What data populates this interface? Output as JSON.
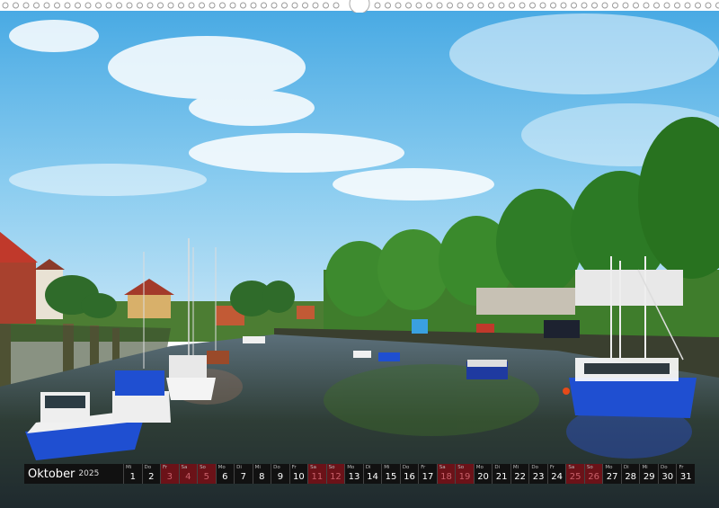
{
  "calendar": {
    "month": "Oktober",
    "year": "2025",
    "days": [
      {
        "dow": "Mi",
        "num": "1",
        "weekend": false
      },
      {
        "dow": "Do",
        "num": "2",
        "weekend": false
      },
      {
        "dow": "Fr",
        "num": "3",
        "weekend": true
      },
      {
        "dow": "Sa",
        "num": "4",
        "weekend": true
      },
      {
        "dow": "So",
        "num": "5",
        "weekend": true
      },
      {
        "dow": "Mo",
        "num": "6",
        "weekend": false
      },
      {
        "dow": "Di",
        "num": "7",
        "weekend": false
      },
      {
        "dow": "Mi",
        "num": "8",
        "weekend": false
      },
      {
        "dow": "Do",
        "num": "9",
        "weekend": false
      },
      {
        "dow": "Fr",
        "num": "10",
        "weekend": false
      },
      {
        "dow": "Sa",
        "num": "11",
        "weekend": true
      },
      {
        "dow": "So",
        "num": "12",
        "weekend": true
      },
      {
        "dow": "Mo",
        "num": "13",
        "weekend": false
      },
      {
        "dow": "Di",
        "num": "14",
        "weekend": false
      },
      {
        "dow": "Mi",
        "num": "15",
        "weekend": false
      },
      {
        "dow": "Do",
        "num": "16",
        "weekend": false
      },
      {
        "dow": "Fr",
        "num": "17",
        "weekend": false
      },
      {
        "dow": "Sa",
        "num": "18",
        "weekend": true
      },
      {
        "dow": "So",
        "num": "19",
        "weekend": true
      },
      {
        "dow": "Mo",
        "num": "20",
        "weekend": false
      },
      {
        "dow": "Di",
        "num": "21",
        "weekend": false
      },
      {
        "dow": "Mi",
        "num": "22",
        "weekend": false
      },
      {
        "dow": "Do",
        "num": "23",
        "weekend": false
      },
      {
        "dow": "Fr",
        "num": "24",
        "weekend": false
      },
      {
        "dow": "Sa",
        "num": "25",
        "weekend": true
      },
      {
        "dow": "So",
        "num": "26",
        "weekend": true
      },
      {
        "dow": "Mo",
        "num": "27",
        "weekend": false
      },
      {
        "dow": "Di",
        "num": "28",
        "weekend": false
      },
      {
        "dow": "Mi",
        "num": "29",
        "weekend": false
      },
      {
        "dow": "Do",
        "num": "30",
        "weekend": false
      },
      {
        "dow": "Fr",
        "num": "31",
        "weekend": false
      }
    ]
  },
  "colors": {
    "bar": "#111111",
    "weekend_cell": "#6b1218",
    "weekend_text": "#c9606a",
    "sky_top": "#4fb0e6",
    "water": "#2c3a4a",
    "boat_blue": "#1f4fd1"
  },
  "icons": [
    "spiral-binding-icon",
    "hanger-hole-icon"
  ]
}
